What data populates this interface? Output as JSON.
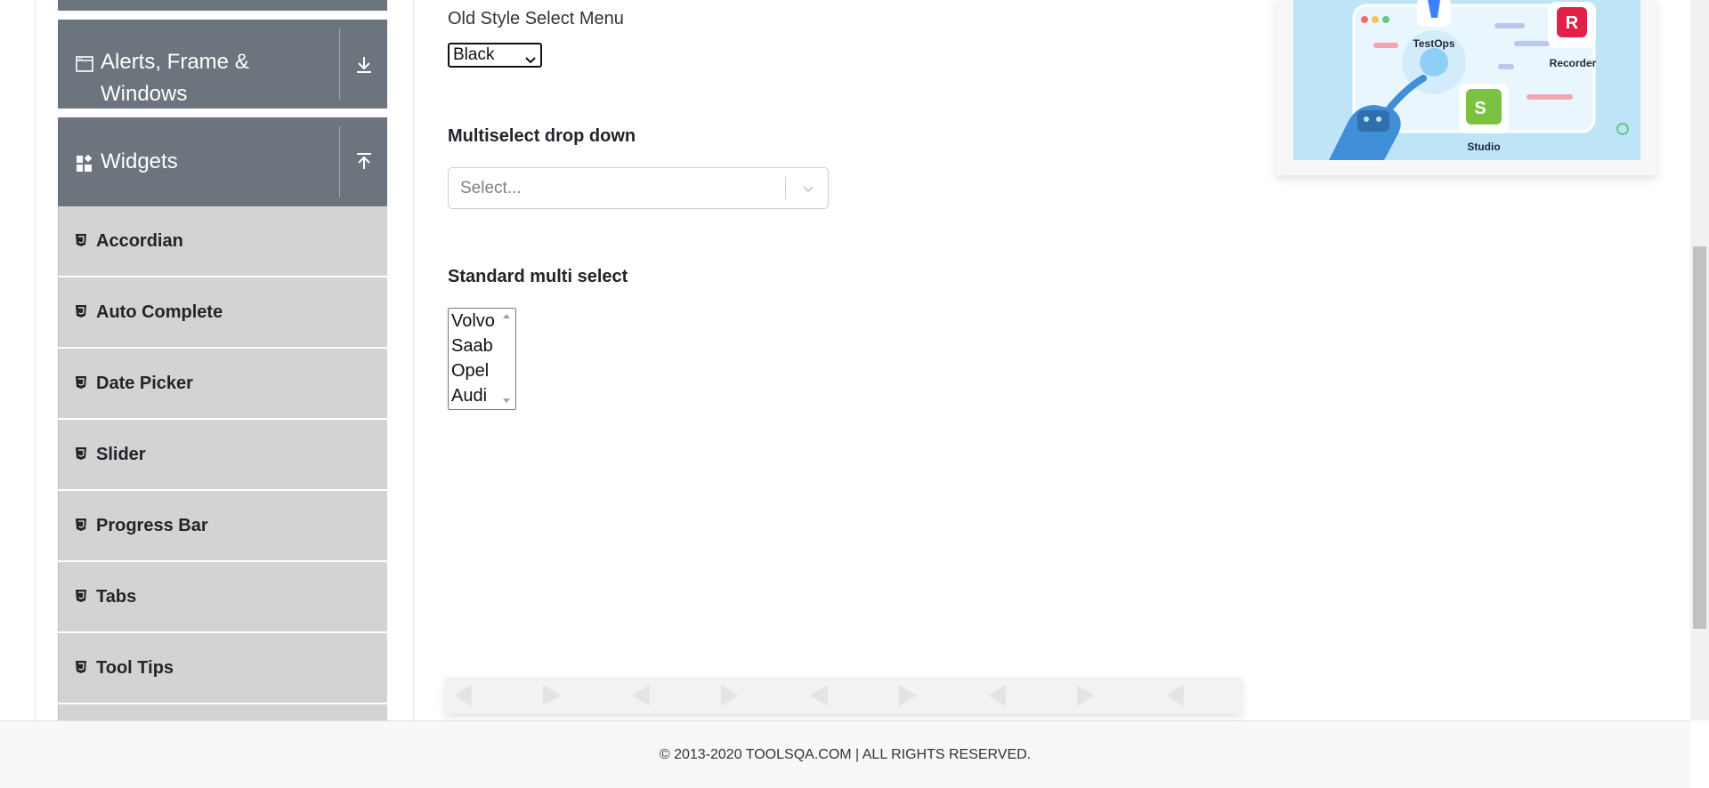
{
  "sidebar": {
    "groups": {
      "alerts": {
        "label": "Alerts, Frame & Windows",
        "line1": "Alerts, Frame &",
        "line2": "Windows"
      },
      "widgets": {
        "label": "Widgets"
      }
    },
    "items": [
      {
        "label": "Accordian"
      },
      {
        "label": "Auto Complete"
      },
      {
        "label": "Date Picker"
      },
      {
        "label": "Slider"
      },
      {
        "label": "Progress Bar"
      },
      {
        "label": "Tabs"
      },
      {
        "label": "Tool Tips"
      }
    ]
  },
  "main": {
    "old_select": {
      "label": "Old Style Select Menu",
      "value": "Black"
    },
    "multiselect": {
      "label": "Multiselect drop down",
      "placeholder": "Select..."
    },
    "standard_multi": {
      "label": "Standard multi select",
      "options": [
        "Volvo",
        "Saab",
        "Opel",
        "Audi"
      ]
    }
  },
  "ad": {
    "labels": {
      "testops": "TestOps",
      "recorder": "Recorder",
      "studio": "Studio"
    },
    "letters": {
      "recorder": "R",
      "studio": "S"
    }
  },
  "footer": {
    "text": "© 2013-2020 TOOLSQA.COM | ALL RIGHTS RESERVED."
  },
  "colors": {
    "header": "#6c757d",
    "menu_item": "#d3d3d3",
    "ad_bg": "#bfe3f7"
  }
}
